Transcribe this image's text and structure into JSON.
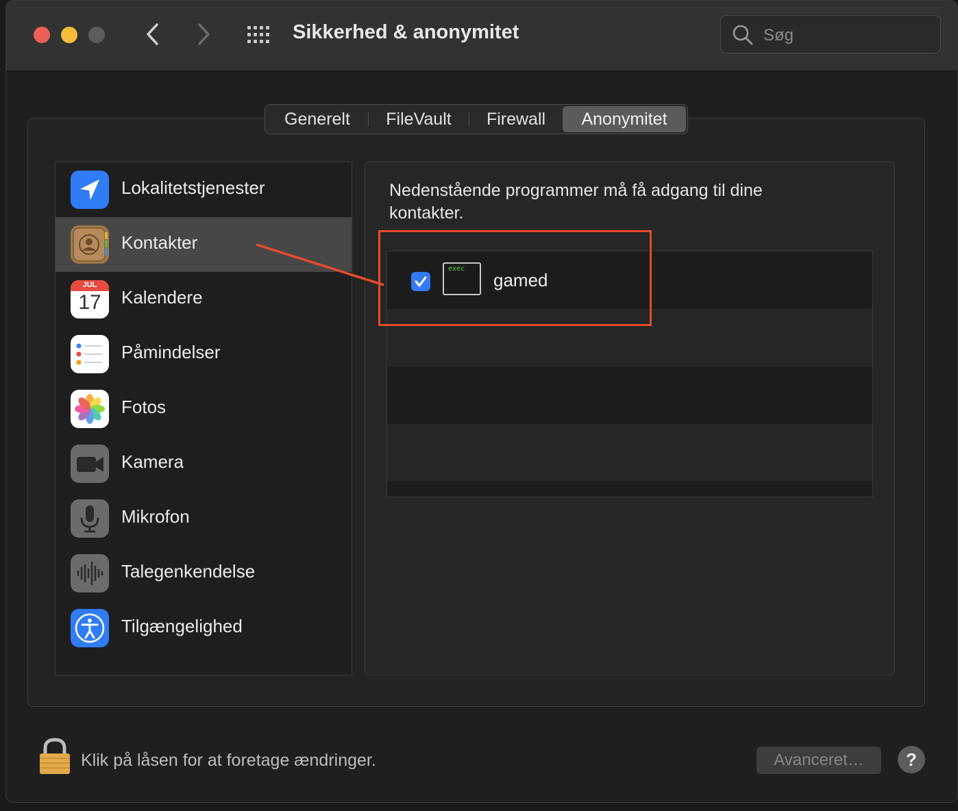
{
  "window": {
    "title": "Sikkerhed & anonymitet"
  },
  "search": {
    "placeholder": "Søg"
  },
  "tabs": [
    {
      "label": "Generelt",
      "selected": false
    },
    {
      "label": "FileVault",
      "selected": false
    },
    {
      "label": "Firewall",
      "selected": false
    },
    {
      "label": "Anonymitet",
      "selected": true
    }
  ],
  "sidebar": {
    "items": [
      {
        "label": "Lokalitetstjenester",
        "icon": "location-arrow-icon",
        "selected": false
      },
      {
        "label": "Kontakter",
        "icon": "contacts-icon",
        "selected": true
      },
      {
        "label": "Kalendere",
        "icon": "calendar-icon",
        "selected": false,
        "icon_month": "JUL",
        "icon_day": "17"
      },
      {
        "label": "Påmindelser",
        "icon": "reminders-icon",
        "selected": false
      },
      {
        "label": "Fotos",
        "icon": "photos-icon",
        "selected": false
      },
      {
        "label": "Kamera",
        "icon": "camera-icon",
        "selected": false
      },
      {
        "label": "Mikrofon",
        "icon": "microphone-icon",
        "selected": false
      },
      {
        "label": "Talegenkendelse",
        "icon": "speech-recognition-icon",
        "selected": false
      },
      {
        "label": "Tilgængelighed",
        "icon": "accessibility-icon",
        "selected": false
      }
    ]
  },
  "detail": {
    "description": "Nedenstående programmer må få adgang til dine kontakter.",
    "apps": [
      {
        "name": "gamed",
        "checked": true,
        "icon": "exec-icon",
        "icon_text": "exec"
      }
    ]
  },
  "footer": {
    "lock_text": "Klik på låsen for at foretage ændringer.",
    "advanced_label": "Avanceret…",
    "help_label": "?"
  },
  "colors": {
    "accent": "#3478f6",
    "annotation": "#e64a2e",
    "selected_row": "#474747"
  }
}
